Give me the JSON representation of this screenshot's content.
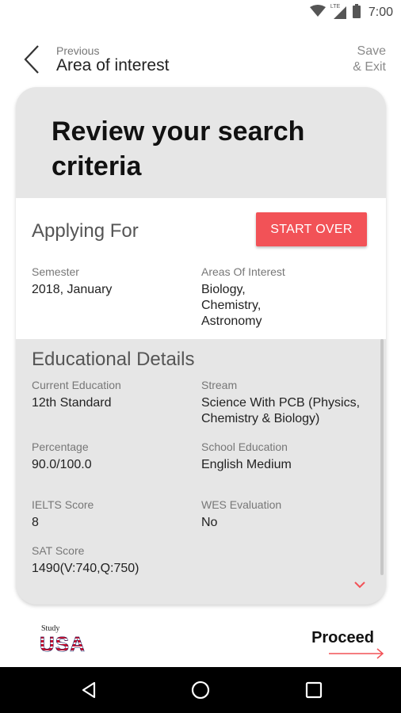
{
  "status_bar": {
    "time": "7:00",
    "network_label": "LTE",
    "icons": [
      "wifi-icon",
      "cell-signal-icon",
      "battery-icon"
    ]
  },
  "header": {
    "previous_label": "Previous",
    "previous_title": "Area of interest",
    "save_exit_line1": "Save",
    "save_exit_line2": "& Exit"
  },
  "card": {
    "title": "Review your search criteria",
    "applying": {
      "heading": "Applying For",
      "start_over": "START OVER",
      "semester_label": "Semester",
      "semester_value": "2018, January",
      "areas_label": "Areas Of Interest",
      "areas_values": [
        "Biology,",
        "Chemistry,",
        "Astronomy"
      ]
    },
    "education": {
      "heading": "Educational Details",
      "current_education_label": "Current Education",
      "current_education_value": "12th Standard",
      "stream_label": "Stream",
      "stream_values": [
        "Science With PCB (Physics,",
        "Chemistry & Biology)"
      ],
      "percentage_label": "Percentage",
      "percentage_value": "90.0/100.0",
      "school_education_label": "School Education",
      "school_education_value": "English Medium",
      "ielts_label": "IELTS Score",
      "ielts_value": "8",
      "wes_label": "WES Evaluation",
      "wes_value": "No",
      "sat_label": "SAT Score",
      "sat_value": "1490(V:740,Q:750)"
    }
  },
  "footer": {
    "logo_small": "Study",
    "logo_big": "USA",
    "proceed": "Proceed"
  },
  "colors": {
    "accent": "#f25257",
    "card_background": "#e6e6e6",
    "nav_bar": "#000000"
  }
}
